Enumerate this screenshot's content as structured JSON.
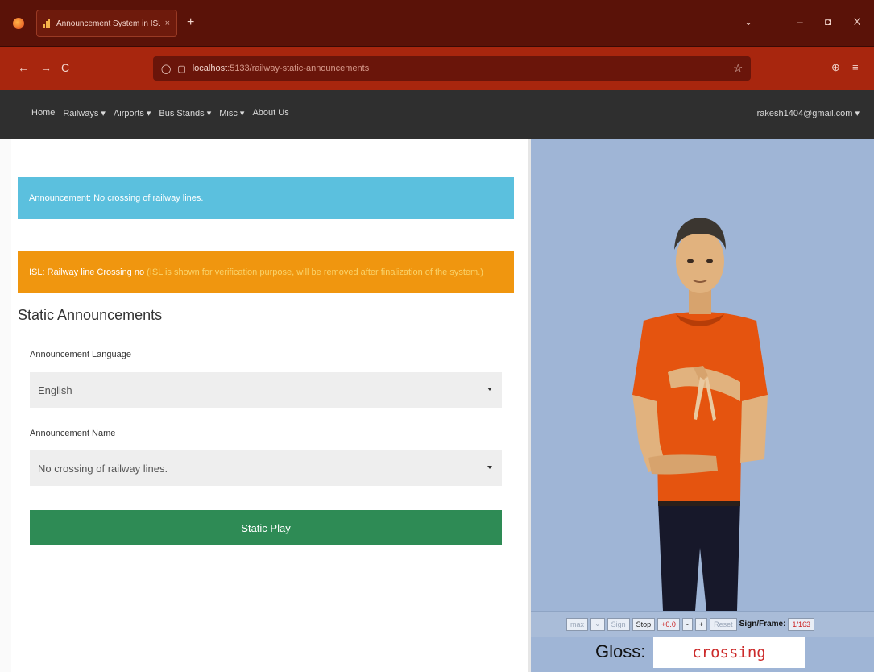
{
  "browser": {
    "tab_title": "Announcement System in ISL",
    "tab_close": "×",
    "new_tab": "+",
    "url_host": "localhost",
    "url_path": ":5133/railway-static-announcements",
    "back": "←",
    "forward": "→",
    "reload": "C",
    "bookmark_star": "☆",
    "pocket": "⊕",
    "menu": "≡",
    "window_controls": {
      "dropdown": "⌄",
      "minimize": "–",
      "maximize": "◘",
      "close": "X"
    }
  },
  "sitenav": {
    "items": [
      "Home",
      "Railways ▾",
      "Airports ▾",
      "Bus Stands ▾",
      "Misc ▾",
      "About Us"
    ],
    "user": "rakesh1404@gmail.com ▾"
  },
  "alerts": {
    "announcement": "Announcement: No crossing of railway lines.",
    "isl_prefix": "ISL: Railway line Crossing no",
    "isl_note": " (ISL is shown for verification purpose, will be removed after finalization of the system.)"
  },
  "form": {
    "section_title": "Static Announcements",
    "language_label": "Announcement Language",
    "language_value": "English",
    "name_label": "Announcement Name",
    "name_value": "No crossing of railway lines.",
    "play_button": "Static Play"
  },
  "player": {
    "speed_select": "max",
    "sign_button": "Sign",
    "stop_button": "Stop",
    "speed_value": "+0.0",
    "minus": "-",
    "plus": "+",
    "reset_button": "Reset",
    "sign_frame_label": "Sign/Frame:",
    "sign_frame_value": "1/163",
    "gloss_label": "Gloss:",
    "gloss_value": "crossing"
  },
  "colors": {
    "info": "#5bc0de",
    "warning": "#f0960f",
    "play": "#2e8b55",
    "avatar_bg": "#9fb5d6",
    "shirt": "#e5540f"
  }
}
